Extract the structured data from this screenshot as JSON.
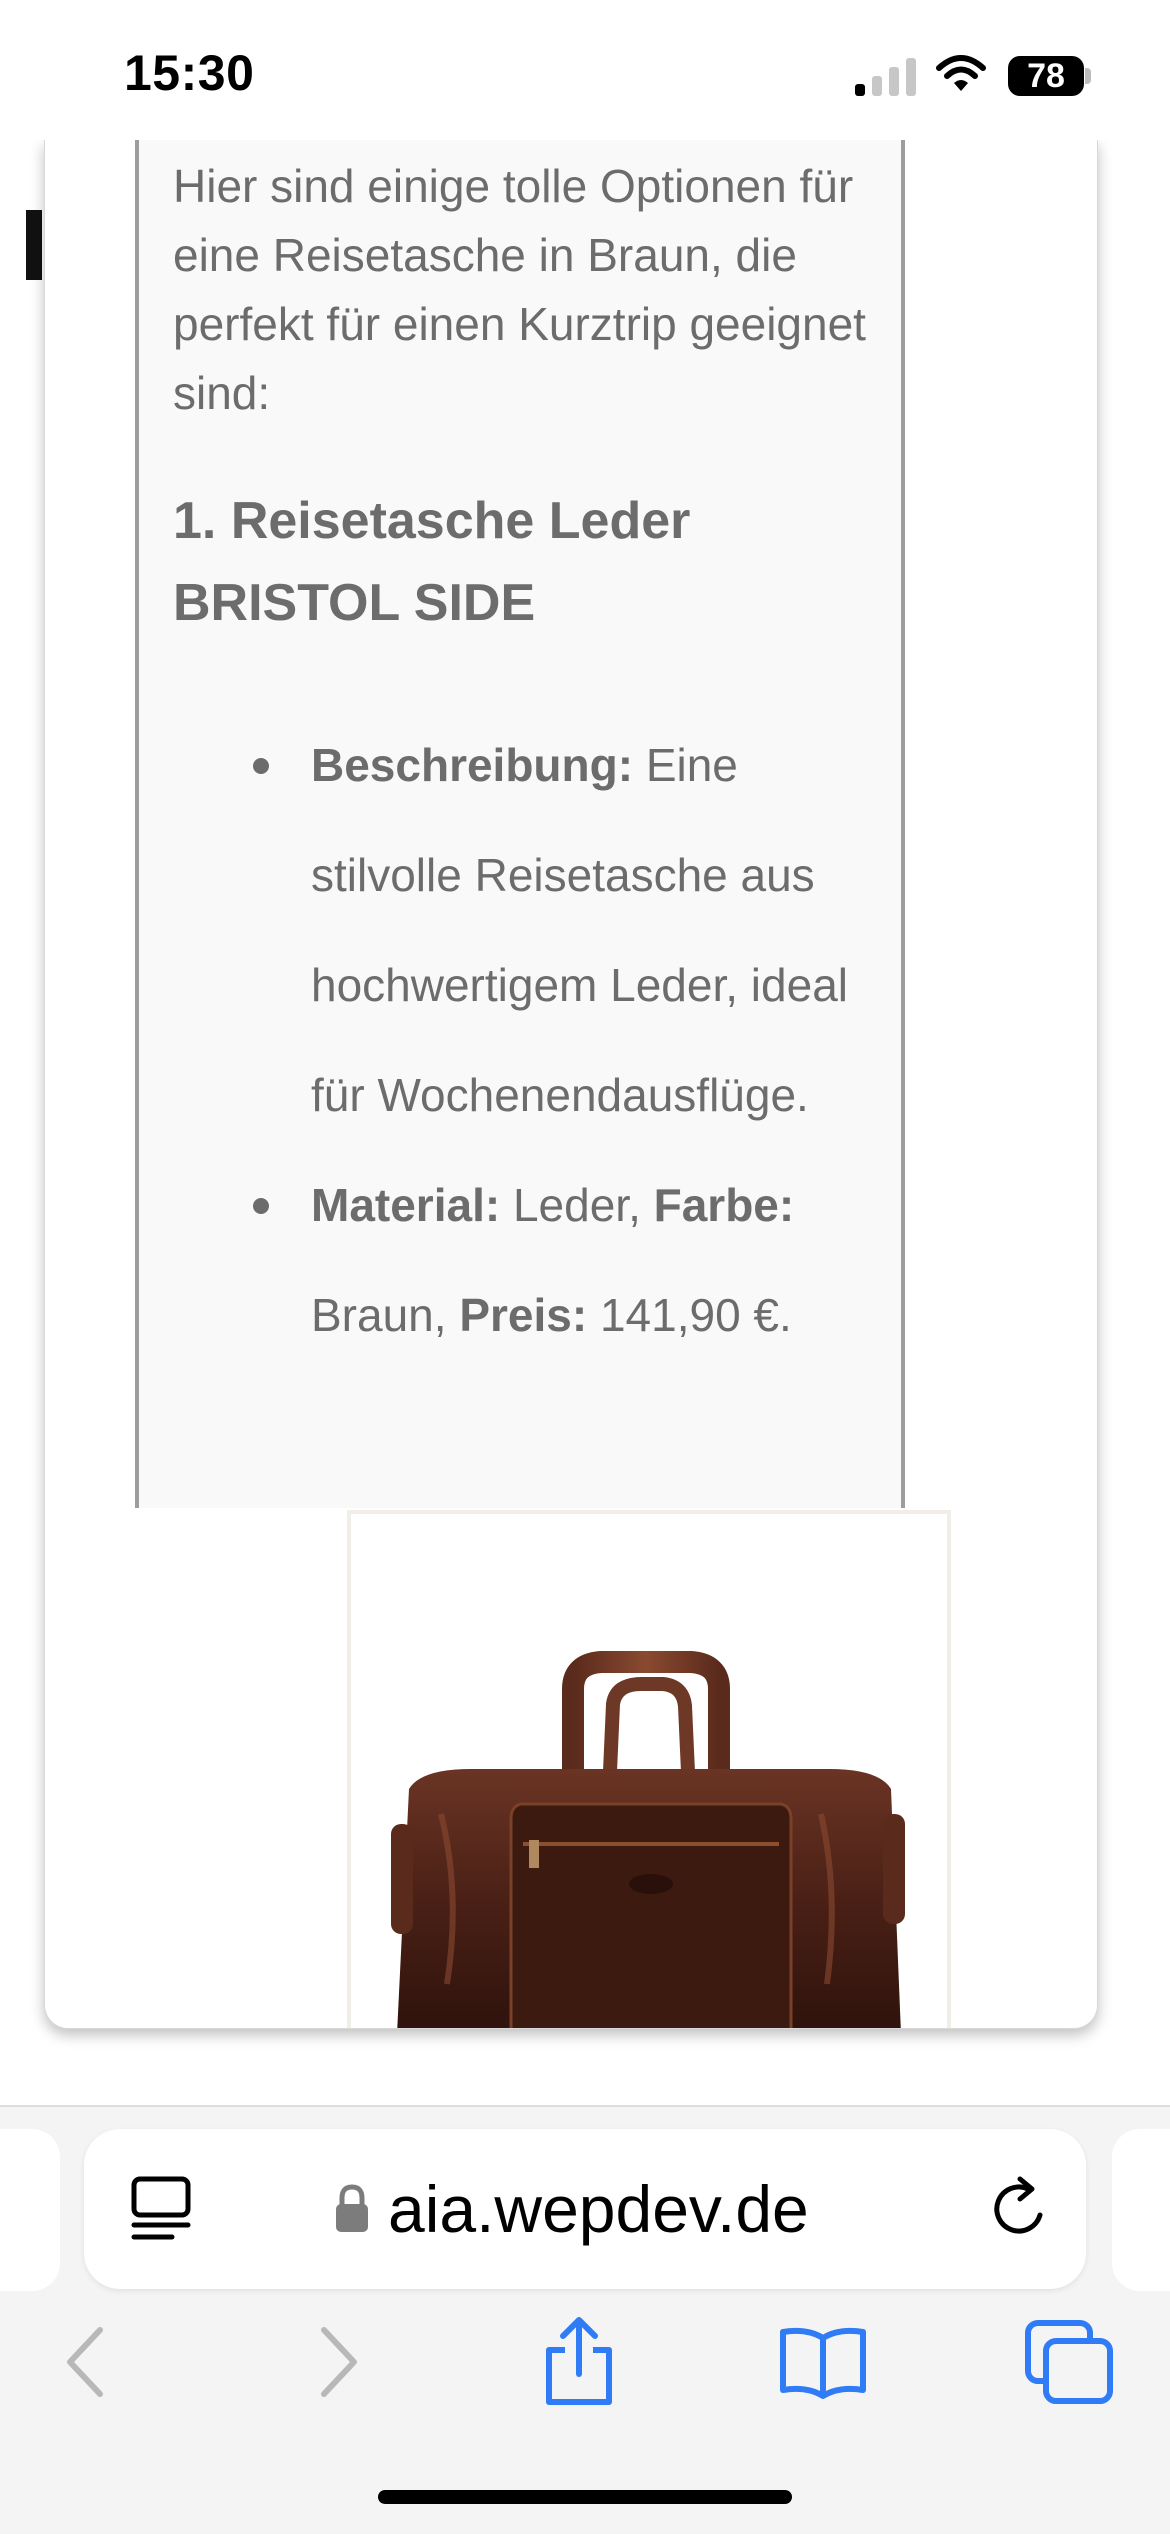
{
  "status_bar": {
    "time": "15:30",
    "battery_percent": "78",
    "signal_icon": "cellular-signal-icon",
    "wifi_icon": "wifi-icon",
    "battery_icon": "battery-icon"
  },
  "content": {
    "intro": "Hier sind einige tolle Optionen für eine Reisetasche in Braun, die perfekt für einen Kurztrip geeignet sind:",
    "heading": "1. Reisetasche Leder BRISTOL SIDE",
    "bullets": {
      "description_label": "Beschreibung:",
      "description_text": " Eine stilvolle Reisetasche aus hochwertigem Leder, ideal für Wochenendausflüge.",
      "material_label": "Material:",
      "material_value": " Leder, ",
      "color_label": "Farbe:",
      "color_value": " Braun, ",
      "price_label": "Preis:",
      "price_value": " 141,90 €."
    },
    "product_image_icon": "leather-travel-bag-image"
  },
  "browser": {
    "url": "aia.wepdev.de",
    "reader_icon": "reader-mode-icon",
    "lock_icon": "lock-icon",
    "reload_icon": "reload-icon",
    "nav_icons": [
      "back-icon",
      "forward-icon",
      "share-icon",
      "bookmarks-icon",
      "tabs-icon"
    ]
  },
  "colors": {
    "accent": "#2f7cf6",
    "text_gray": "#6c6c6c",
    "disabled_gray": "#b8b8b8"
  }
}
